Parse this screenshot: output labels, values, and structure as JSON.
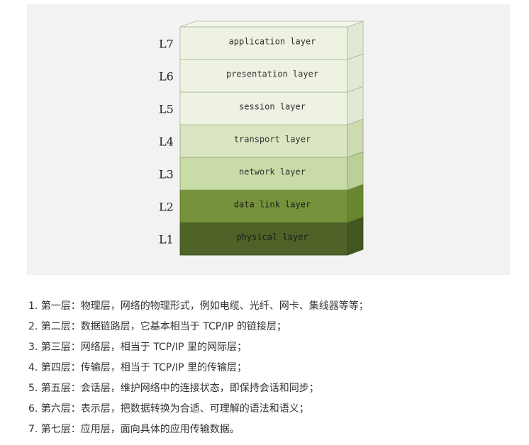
{
  "diagram": {
    "layers": [
      {
        "code": "L7",
        "name": "application layer",
        "front_color": "#edf2e2",
        "top_color": "#f3f7eb",
        "side_color": "#e2e9d2",
        "stroke_color": "#aab49a",
        "text_color": "#333333"
      },
      {
        "code": "L6",
        "name": "presentation layer",
        "front_color": "#edf2e2",
        "top_color": "#f3f7eb",
        "side_color": "#e2e9d2",
        "stroke_color": "#aab49a",
        "text_color": "#333333"
      },
      {
        "code": "L5",
        "name": "session layer",
        "front_color": "#edf2e2",
        "top_color": "#f3f7eb",
        "side_color": "#e2e9d2",
        "stroke_color": "#aab49a",
        "text_color": "#333333"
      },
      {
        "code": "L4",
        "name": "transport layer",
        "front_color": "#d9e6c1",
        "top_color": "#e4eed2",
        "side_color": "#ccdcb0",
        "stroke_color": "#95a57c",
        "text_color": "#333333"
      },
      {
        "code": "L3",
        "name": "network layer",
        "front_color": "#c9dca8",
        "top_color": "#d6e6ba",
        "side_color": "#bad096",
        "stroke_color": "#88a06a",
        "text_color": "#333333"
      },
      {
        "code": "L2",
        "name": "data link layer",
        "front_color": "#76933c",
        "top_color": "#88a44f",
        "side_color": "#68852f",
        "stroke_color": "#56702a",
        "text_color": "#1f1f1f"
      },
      {
        "code": "L1",
        "name": "physical layer",
        "front_color": "#4f6228",
        "top_color": "#5f7433",
        "side_color": "#44561f",
        "stroke_color": "#3a4a1c",
        "text_color": "#1a1a1a"
      }
    ]
  },
  "notes": [
    "1. 第一层：物理层，网络的物理形式，例如电缆、光纤、网卡、集线器等等；",
    "2. 第二层：数据链路层，它基本相当于 TCP/IP 的链接层；",
    "3. 第三层：网络层，相当于 TCP/IP 里的网际层；",
    "4. 第四层：传输层，相当于 TCP/IP 里的传输层；",
    "5. 第五层：会话层，维护网络中的连接状态，即保持会话和同步；",
    "6. 第六层：表示层，把数据转换为合适、可理解的语法和语义；",
    "7. 第七层：应用层，面向具体的应用传输数据。"
  ]
}
